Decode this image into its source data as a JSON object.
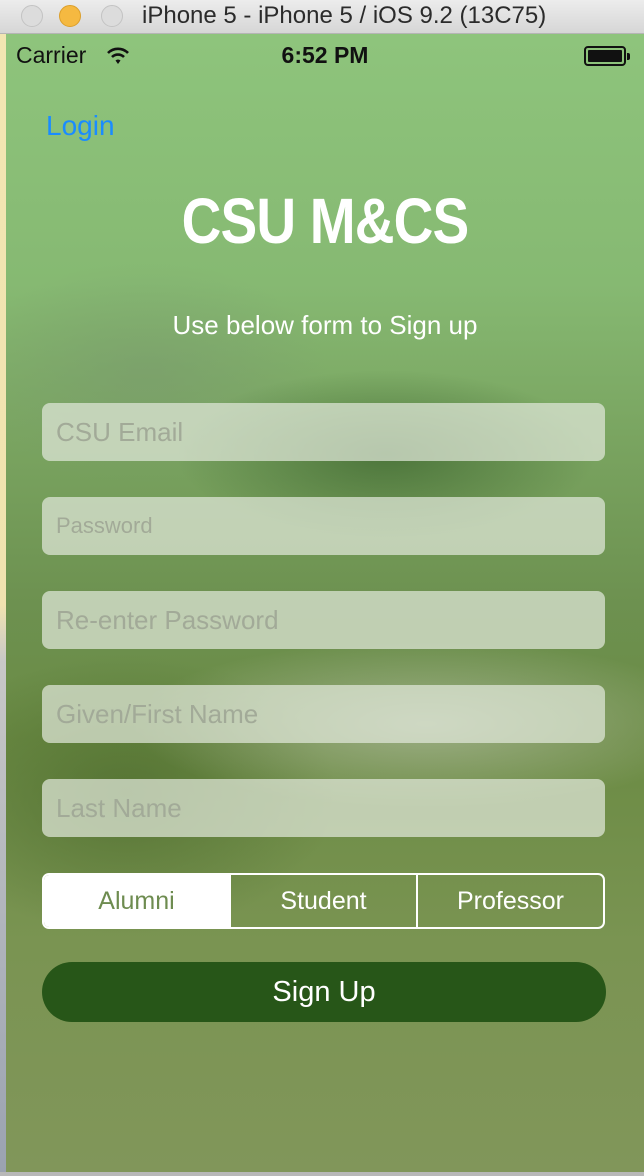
{
  "window": {
    "title": "iPhone 5 - iPhone 5 / iOS 9.2 (13C75)"
  },
  "status_bar": {
    "carrier": "Carrier",
    "time": "6:52 PM"
  },
  "nav": {
    "back_label": "Login"
  },
  "header": {
    "title": "CSU M&CS",
    "subtitle": "Use below form to Sign up"
  },
  "form": {
    "email_placeholder": "CSU Email",
    "password_placeholder": "Password",
    "reenter_password_placeholder": "Re-enter Password",
    "first_name_placeholder": "Given/First Name",
    "last_name_placeholder": "Last Name"
  },
  "role_selector": {
    "options": [
      "Alumni",
      "Student",
      "Professor"
    ],
    "selected": "Alumni"
  },
  "actions": {
    "signup_label": "Sign Up"
  },
  "colors": {
    "link": "#1a8cff",
    "button_bg": "#275618",
    "segment_selected_text": "#6e8c50"
  },
  "icons": [
    "wifi-icon",
    "battery-icon",
    "close-window-icon",
    "minimize-window-icon",
    "zoom-window-icon"
  ]
}
